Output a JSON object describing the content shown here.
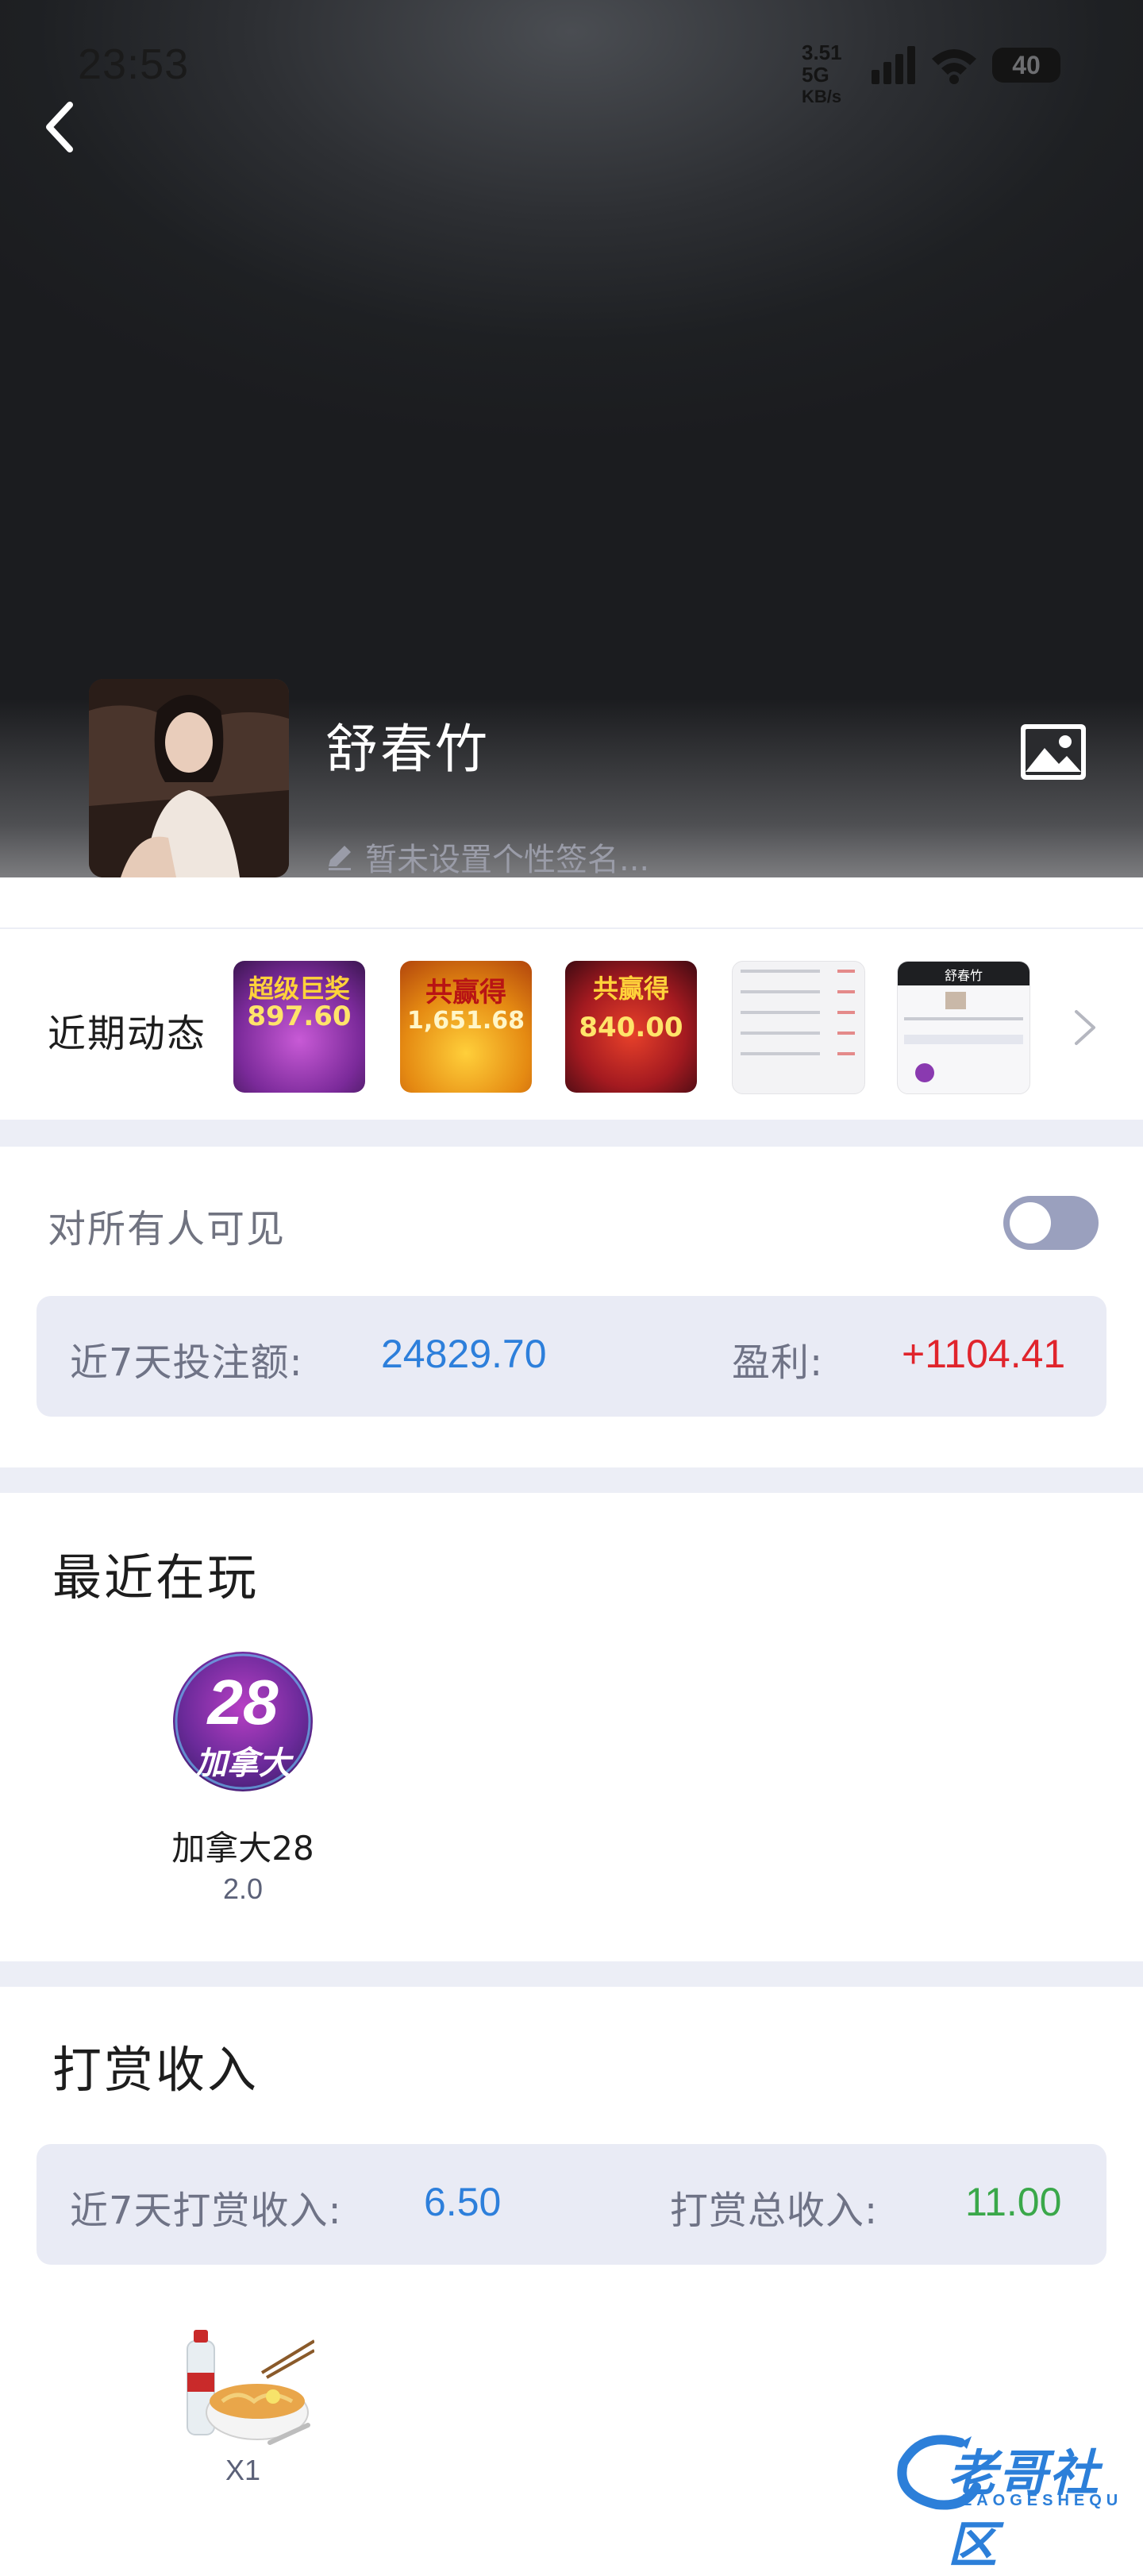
{
  "status_bar": {
    "time": "23:53",
    "net_speed": "3.51",
    "net_type": "5G",
    "net_unit": "KB/s",
    "battery": "40"
  },
  "profile": {
    "name": "舒春竹",
    "signature": "暂未设置个性签名..."
  },
  "moments": {
    "label": "近期动态",
    "thumbnails": [
      {
        "title": "超级巨奖",
        "amount": "897.60"
      },
      {
        "title": "共赢得",
        "amount": "1,651.68"
      },
      {
        "title": "共赢得",
        "amount": "840.00"
      },
      {
        "title": "",
        "amount": ""
      },
      {
        "title": "舒春竹",
        "amount": ""
      }
    ]
  },
  "visibility": {
    "label": "对所有人可见",
    "enabled": false
  },
  "bet_stats": {
    "bet_label": "近7天投注额:",
    "bet_value": "24829.70",
    "profit_label": "盈利:",
    "profit_value": "+1104.41"
  },
  "recent_play": {
    "title": "最近在玩",
    "games": [
      {
        "icon_text": "28",
        "icon_subtext": "加拿大",
        "name": "加拿大28",
        "value": "2.0"
      }
    ]
  },
  "tips": {
    "title": "打赏收入",
    "week_label": "近7天打赏收入:",
    "week_value": "6.50",
    "total_label": "打赏总收入:",
    "total_value": "11.00",
    "gifts": [
      {
        "icon": "noodle-bowl-and-water-bottle-icon",
        "count": "X1"
      }
    ]
  },
  "watermark": {
    "main": "老哥社区",
    "sub": "LAOGESHEQU"
  },
  "colors": {
    "blue_value": "#2d7fdb",
    "red_value": "#e0242c",
    "green_value": "#3aa84a",
    "card_bg": "#e9ebf5",
    "divider": "#eceef6"
  }
}
